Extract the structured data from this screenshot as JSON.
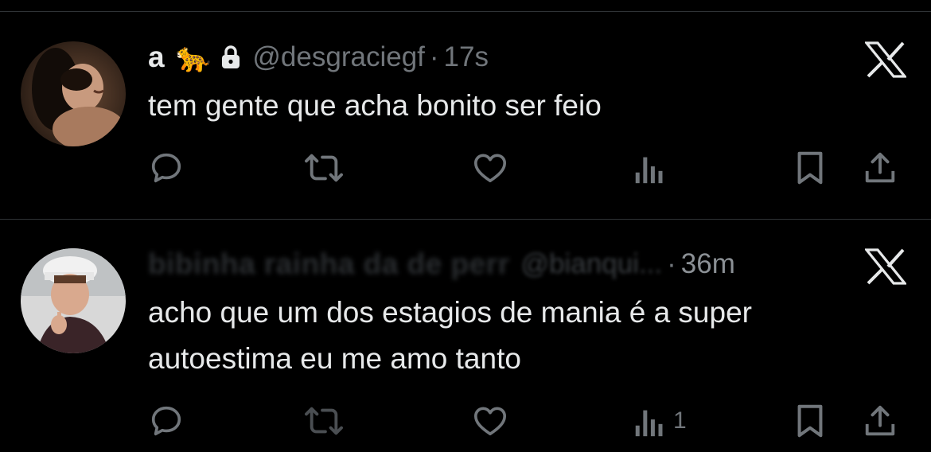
{
  "colors": {
    "background": "#000000",
    "text": "#e7e9ea",
    "secondary": "#71767b",
    "divider": "#2f3336"
  },
  "tweets": [
    {
      "display_name": "a",
      "name_emoji": "🐆",
      "protected": true,
      "handle": "@desgraciegf",
      "separator": "·",
      "time": "17s",
      "text": "tem gente que acha bonito ser feio",
      "actions": {
        "reply": "",
        "retweet": "",
        "like": "",
        "views": "",
        "icons": [
          "reply-icon",
          "retweet-icon",
          "like-icon",
          "views-icon",
          "bookmark-icon",
          "share-icon"
        ]
      }
    },
    {
      "display_name": "bibinha rainha da de perr",
      "handle": "@bianqui...",
      "separator": "·",
      "time": "36m",
      "text": "acho que um dos estagios de mania é a super autoestima eu me amo tanto",
      "actions": {
        "reply": "",
        "retweet": "",
        "like": "",
        "views": "1",
        "icons": [
          "reply-icon",
          "retweet-icon",
          "like-icon",
          "views-icon",
          "bookmark-icon",
          "share-icon"
        ]
      }
    }
  ]
}
